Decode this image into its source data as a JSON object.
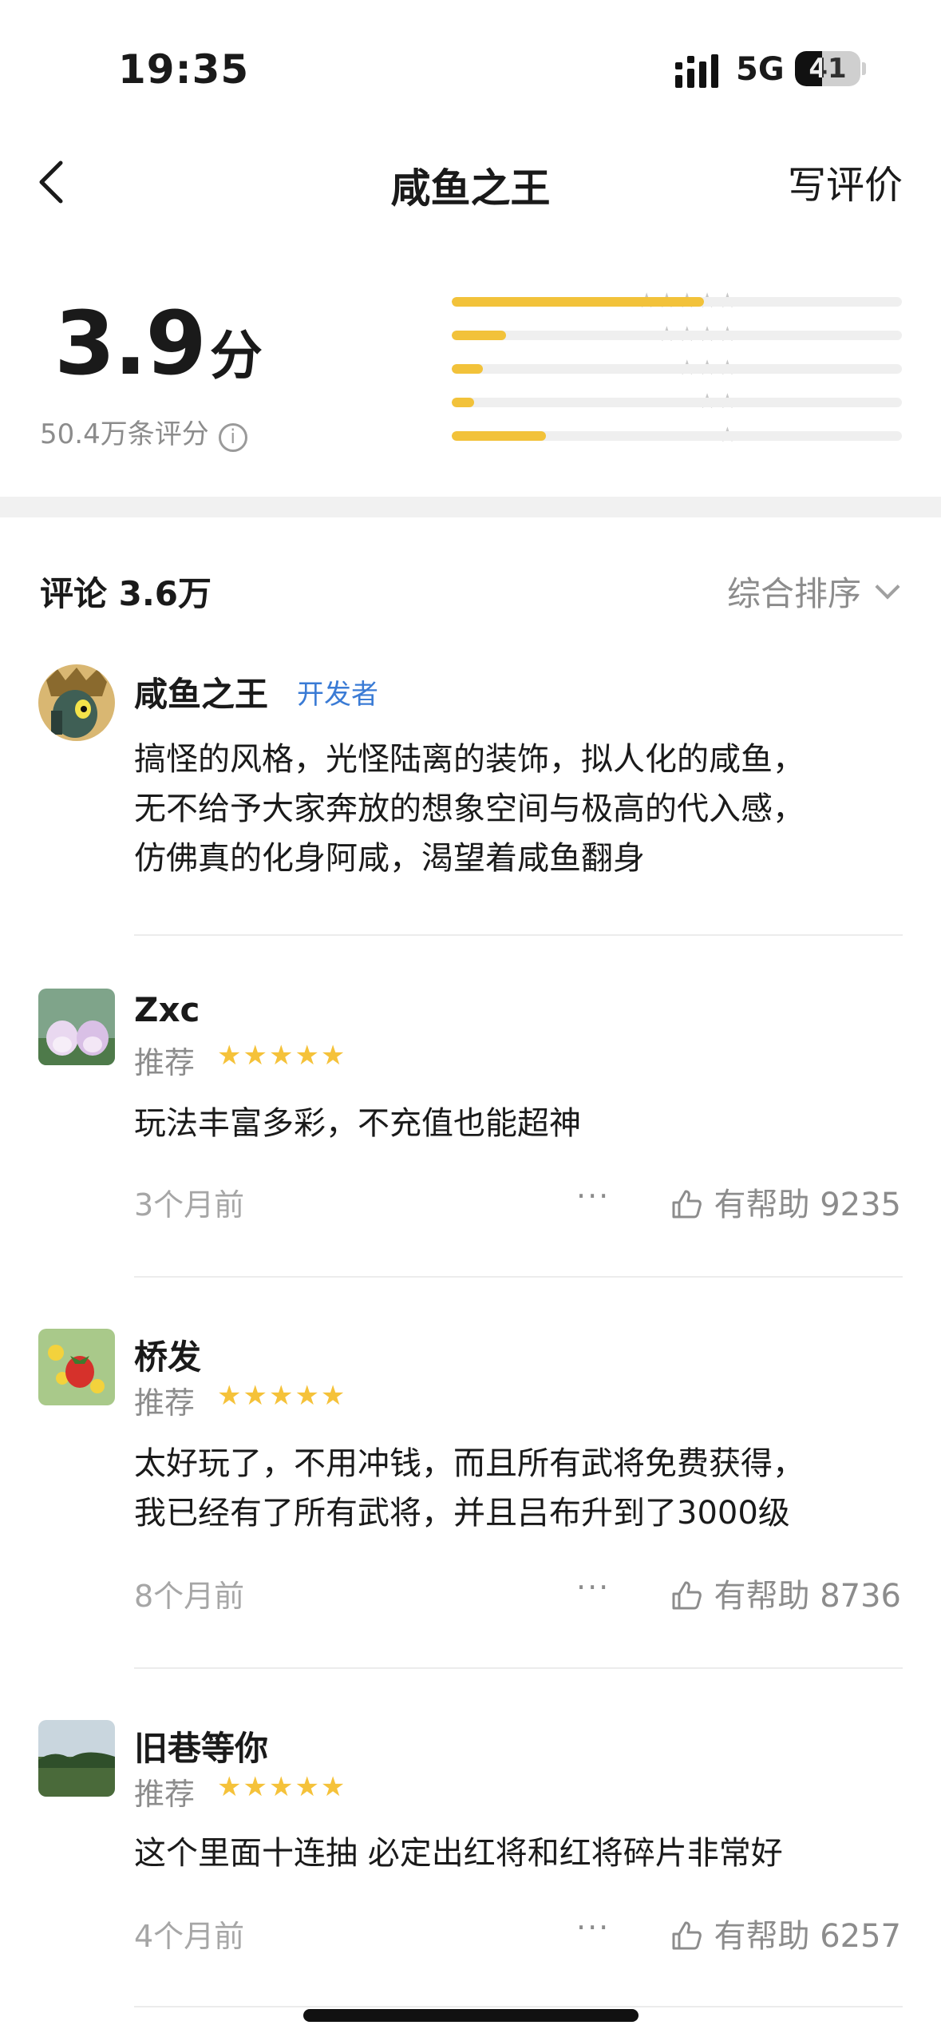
{
  "status_bar": {
    "time": "19:35",
    "network": "5G",
    "battery": "41",
    "battery_level": 0.41
  },
  "nav": {
    "title": "咸鱼之王",
    "write_review": "写评价"
  },
  "rating": {
    "score": "3.9",
    "unit": "分",
    "count": "50.4万条评分",
    "info_icon": "i",
    "distribution": [
      {
        "stars": 5,
        "fraction": 0.56
      },
      {
        "stars": 4,
        "fraction": 0.12
      },
      {
        "stars": 3,
        "fraction": 0.07
      },
      {
        "stars": 2,
        "fraction": 0.05
      },
      {
        "stars": 1,
        "fraction": 0.21
      }
    ],
    "star_color": "#f2c23a"
  },
  "comments": {
    "title": "评论 3.6万",
    "sort_label": "综合排序"
  },
  "developer_post": {
    "name": "咸鱼之王",
    "badge": "开发者",
    "lines": [
      "搞怪的风格，光怪陆离的装饰，拟人化的咸鱼，",
      "无不给予大家奔放的想象空间与极高的代入感，",
      "仿佛真的化身阿咸，渴望着咸鱼翻身"
    ]
  },
  "reviews": [
    {
      "name": "Zxc",
      "recommend": "推荐",
      "stars": "★★★★★",
      "lines": [
        "玩法丰富多彩，不充值也能超神"
      ],
      "time": "3个月前",
      "more": "···",
      "helpful": "有帮助 9235"
    },
    {
      "name": "桥发",
      "recommend": "推荐",
      "stars": "★★★★★",
      "lines": [
        "太好玩了，不用冲钱，而且所有武将免费获得，",
        "我已经有了所有武将，并且吕布升到了3000级"
      ],
      "time": "8个月前",
      "more": "···",
      "helpful": "有帮助 8736"
    },
    {
      "name": "旧巷等你",
      "recommend": "推荐",
      "stars": "★★★★★",
      "lines": [
        "这个里面十连抽 必定出红将和红将碎片非常好"
      ],
      "time": "4个月前",
      "more": "···",
      "helpful": "有帮助 6257"
    }
  ],
  "icons": {
    "back": "chevron-left-icon",
    "info": "info-icon",
    "sort": "chevron-down-icon",
    "thumb": "thumbs-up-icon"
  }
}
